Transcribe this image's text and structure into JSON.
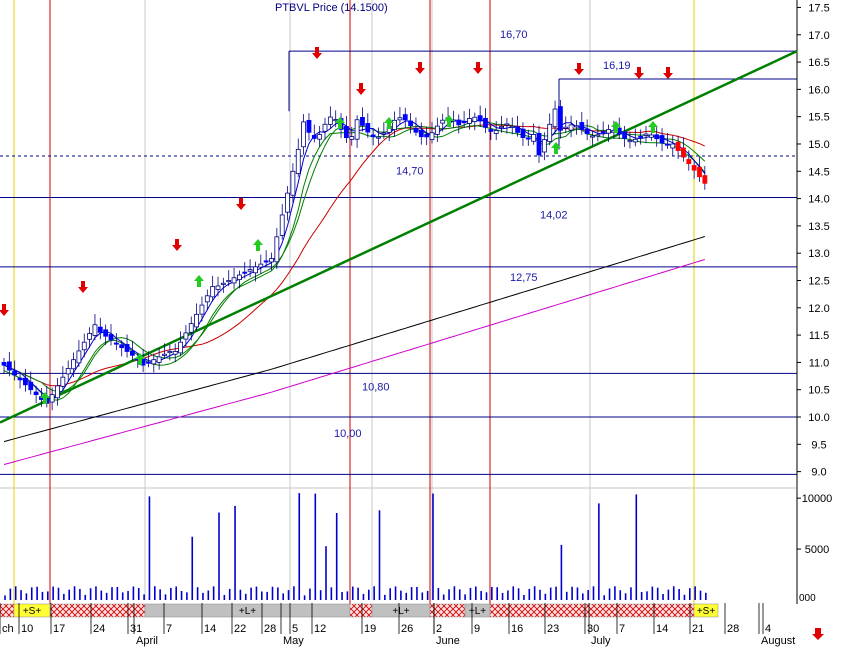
{
  "window": {
    "title": "PTBVL Price (14.1500)"
  },
  "chart_data": {
    "type": "candlestick",
    "title": "PTBVL Price (14.1500)",
    "ylim": [
      8.7,
      17.6
    ],
    "yticks": [
      9.0,
      9.5,
      10.0,
      10.5,
      11.0,
      11.5,
      12.0,
      12.5,
      13.0,
      13.5,
      14.0,
      14.5,
      15.0,
      15.5,
      16.0,
      16.5,
      17.0,
      17.5
    ],
    "ytick_labels": [
      "9.0",
      "9.5",
      "10.0",
      "10.5",
      "11.0",
      "11.5",
      "12.0",
      "12.5",
      "13.0",
      "13.5",
      "14.0",
      "14.5",
      "15.0",
      "15.5",
      "16.0",
      "16.5",
      "17.0",
      "17.5"
    ],
    "volume_ticks": [
      5000,
      10000
    ],
    "volume_tick_labels": [
      "5000",
      "10000"
    ],
    "volume_max": 10800,
    "volume_zero_label": "000",
    "x_labels": [
      "ch",
      "10",
      "17",
      "24",
      "31",
      "April",
      "7",
      "14",
      "22",
      "28",
      "May",
      "5",
      "12",
      "19",
      "26",
      "2",
      "June",
      "9",
      "16",
      "23",
      "30",
      "July",
      "7",
      "14",
      "21",
      "28",
      "4",
      "August"
    ],
    "horizontal_levels": [
      {
        "value": 16.7,
        "label": "16,70"
      },
      {
        "value": 16.19,
        "label": "16,19"
      },
      {
        "value": 14.7,
        "label": "14,70"
      },
      {
        "value": 14.02,
        "label": "14,02"
      },
      {
        "value": 12.75,
        "label": "12,75"
      },
      {
        "value": 10.8,
        "label": "10,80"
      },
      {
        "value": 10.0,
        "label": "10,00"
      },
      {
        "value": 8.95,
        "label": ""
      }
    ],
    "support_level": 14.78,
    "signals": [
      {
        "label": "+S+",
        "color": "#ffff33"
      },
      {
        "label": "+L+",
        "color": "#c0c0c0"
      },
      {
        "label": "+L+",
        "color": "#c0c0c0"
      },
      {
        "label": "+L+",
        "color": "#c0c0c0"
      },
      {
        "label": "+S+",
        "color": "#ffff33"
      }
    ],
    "colors": {
      "up": "#0000ff",
      "down": "#ff0000",
      "trend": "#008000",
      "hline": "#00008b",
      "ma_fast": "#0000cd",
      "ma_green": "#008000",
      "ma_red": "#cc0000",
      "ma_black": "#000000",
      "ma_magenta": "#cc00cc",
      "label": "#1a1aa6",
      "volume": "#0000cc",
      "red_vline": "#cc0000",
      "yellow_vline": "#e6d200"
    }
  }
}
